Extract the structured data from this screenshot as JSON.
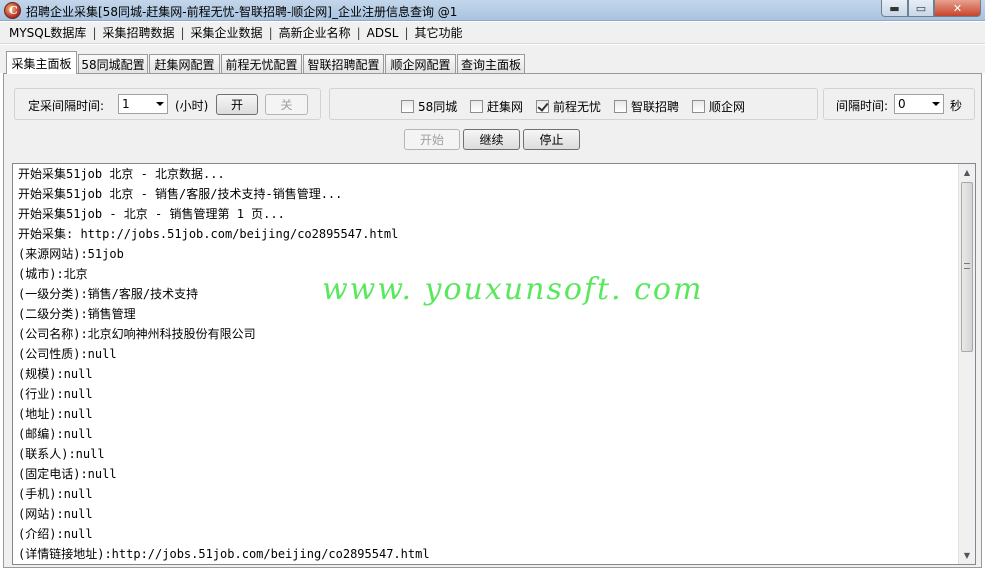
{
  "window": {
    "title": "招聘企业采集[58同城-赶集网-前程无忧-智联招聘-顺企网]_企业注册信息查询  @1",
    "min_glyph": "▬",
    "max_glyph": "▭",
    "close_glyph": "✕"
  },
  "menu": [
    "MYSQL数据库",
    "采集招聘数据",
    "采集企业数据",
    "高新企业名称",
    "ADSL",
    "其它功能"
  ],
  "menu_separator": "|",
  "tabs": [
    "采集主面板",
    "58同城配置",
    "赶集网配置",
    "前程无忧配置",
    "智联招聘配置",
    "顺企网配置",
    "查询主面板"
  ],
  "timer": {
    "label": "定采间隔时间:",
    "value": "1",
    "unit": "(小时)",
    "on_label": "开",
    "off_label": "关"
  },
  "sites": [
    {
      "label": "58同城",
      "checked": false
    },
    {
      "label": "赶集网",
      "checked": false
    },
    {
      "label": "前程无忧",
      "checked": true
    },
    {
      "label": "智联招聘",
      "checked": false
    },
    {
      "label": "顺企网",
      "checked": false
    }
  ],
  "interval": {
    "label": "间隔时间:",
    "value": "0",
    "unit": "秒"
  },
  "actions": {
    "start": "开始",
    "continue": "继续",
    "stop": "停止"
  },
  "log_lines": [
    "开始采集51job  北京  -  北京数据...",
    "开始采集51job  北京  -  销售/客服/技术支持-销售管理...",
    "开始采集51job - 北京 - 销售管理第 1 页...",
    "开始采集: http://jobs.51job.com/beijing/co2895547.html",
    "(来源网站):51job",
    "(城市):北京",
    "(一级分类):销售/客服/技术支持",
    "(二级分类):销售管理",
    "(公司名称):北京幻响神州科技股份有限公司",
    "(公司性质):null",
    "(规模):null",
    "(行业):null",
    "(地址):null",
    "(邮编):null",
    "(联系人):null",
    "(固定电话):null",
    "(手机):null",
    "(网站):null",
    "(介绍):null",
    "(详情链接地址):http://jobs.51job.com/beijing/co2895547.html"
  ],
  "watermark": "www. youxunsoft. com",
  "scroll": {
    "up": "▲",
    "down": "▼"
  }
}
